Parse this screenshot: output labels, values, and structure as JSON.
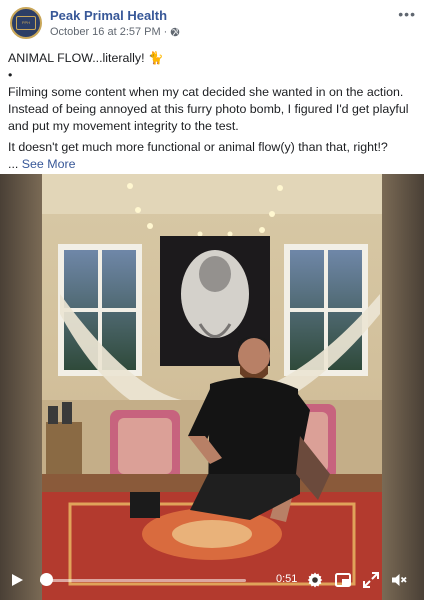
{
  "post": {
    "page_name": "Peak Primal Health",
    "avatar_text": "Peak Primal Health",
    "date": "October 16 at 2:57 PM",
    "separator": "·",
    "more": "•••"
  },
  "caption": {
    "line1": "ANIMAL FLOW...literally! 🐈",
    "bullet": "•",
    "paragraph": "Filming some content when my cat decided she wanted in on the action. Instead of being annoyed at this furry photo bomb, I figured I'd get playful and put my movement integrity to the test.",
    "line3": "It doesn't get much more functional or animal flow(y) than that, right!?",
    "ellipsis": "... ",
    "see_more": "See More"
  },
  "video": {
    "time_remaining": "0:51",
    "progress": 0.01
  },
  "icons": {
    "play": "play-icon",
    "settings": "gear-icon",
    "pip": "picture-in-picture-icon",
    "fullscreen": "fullscreen-icon",
    "mute": "speaker-muted-icon"
  }
}
